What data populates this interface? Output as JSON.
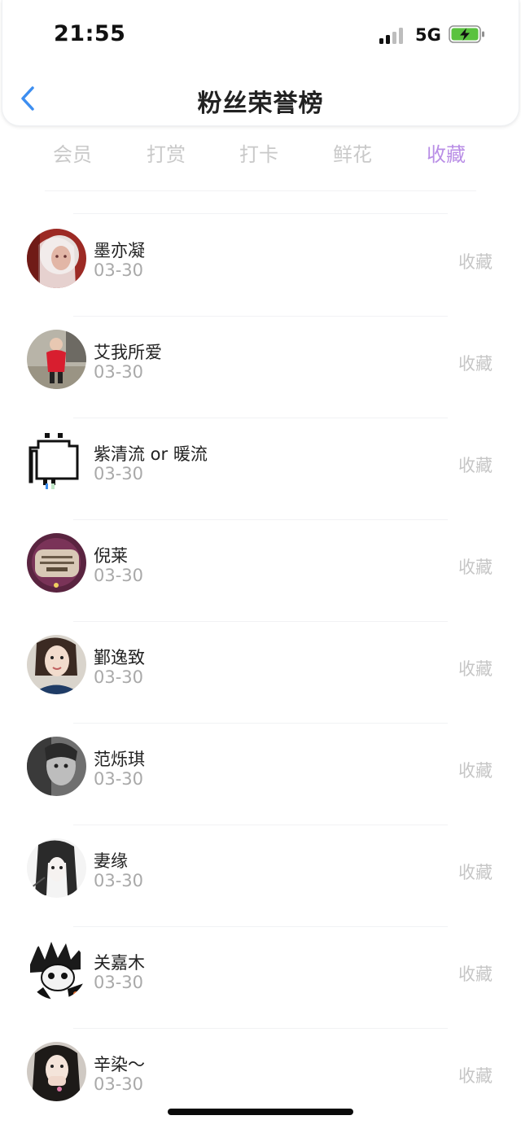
{
  "status_bar": {
    "time": "21:55",
    "network": "5G",
    "battery_color": "#5ac23f"
  },
  "header": {
    "title": "粉丝荣誉榜",
    "back_icon": "chevron-left-icon",
    "accent": "#3d8ef0"
  },
  "tabs": [
    {
      "label": "会员",
      "active": false
    },
    {
      "label": "打赏",
      "active": false
    },
    {
      "label": "打卡",
      "active": false
    },
    {
      "label": "鲜花",
      "active": false
    },
    {
      "label": "收藏",
      "active": true
    }
  ],
  "active_tab_color": "#b98ee6",
  "fans": [
    {
      "name": "墨亦凝",
      "date": "03-30",
      "type": "收藏",
      "avatar": "avatar-white-hair-anime"
    },
    {
      "name": "艾我所爱",
      "date": "03-30",
      "type": "收藏",
      "avatar": "avatar-child-red-coat"
    },
    {
      "name": "紫清流 or 暖流",
      "date": "03-30",
      "type": "收藏",
      "avatar": "avatar-pixel-bun"
    },
    {
      "name": "倪莱",
      "date": "03-30",
      "type": "收藏",
      "avatar": "avatar-sign-board"
    },
    {
      "name": "鄞逸致",
      "date": "03-30",
      "type": "收藏",
      "avatar": "avatar-woman-portrait"
    },
    {
      "name": "范烁琪",
      "date": "03-30",
      "type": "收藏",
      "avatar": "avatar-grayscale-sketch"
    },
    {
      "name": "妻缘",
      "date": "03-30",
      "type": "收藏",
      "avatar": "avatar-anime-girl-sketch"
    },
    {
      "name": "关嘉木",
      "date": "03-30",
      "type": "收藏",
      "avatar": "avatar-manga-spiky-hair"
    },
    {
      "name": "辛染～",
      "date": "03-30",
      "type": "收藏",
      "avatar": "avatar-girl-hand-face"
    }
  ]
}
